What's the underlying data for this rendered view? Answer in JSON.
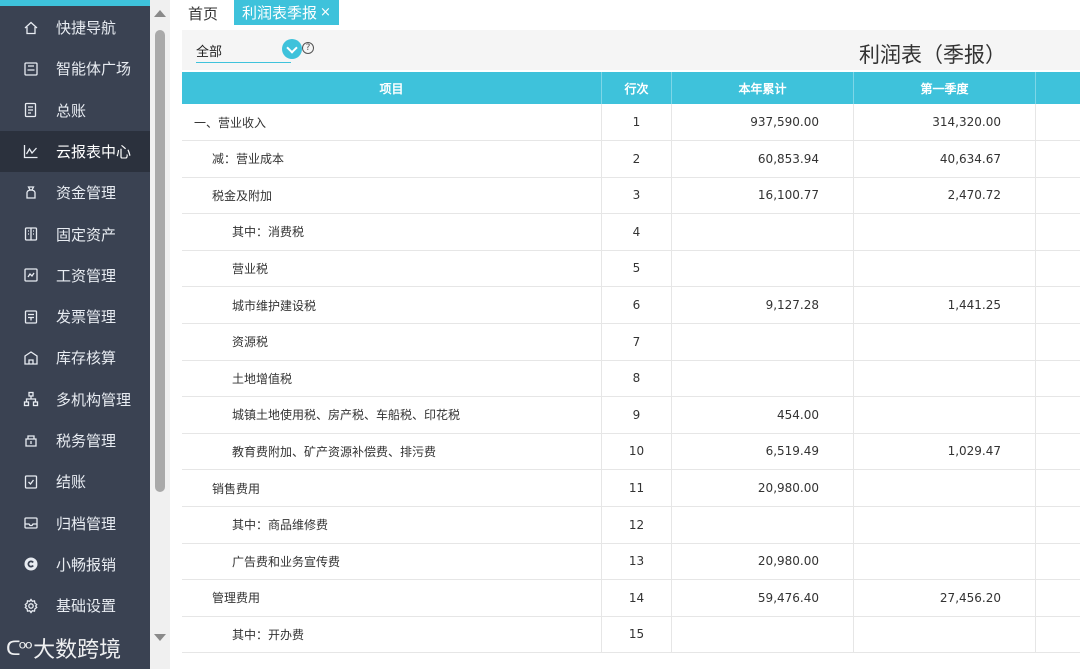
{
  "sidebar": {
    "items": [
      {
        "label": "快捷导航",
        "icon": "home-icon"
      },
      {
        "label": "智能体广场",
        "icon": "agent-icon"
      },
      {
        "label": "总账",
        "icon": "ledger-icon"
      },
      {
        "label": "云报表中心",
        "icon": "chart-icon",
        "active": true
      },
      {
        "label": "资金管理",
        "icon": "money-bag-icon"
      },
      {
        "label": "固定资产",
        "icon": "building-icon"
      },
      {
        "label": "工资管理",
        "icon": "payroll-icon"
      },
      {
        "label": "发票管理",
        "icon": "invoice-icon"
      },
      {
        "label": "库存核算",
        "icon": "warehouse-icon"
      },
      {
        "label": "多机构管理",
        "icon": "org-icon"
      },
      {
        "label": "税务管理",
        "icon": "tax-icon"
      },
      {
        "label": "结账",
        "icon": "checkout-icon"
      },
      {
        "label": "归档管理",
        "icon": "archive-icon"
      },
      {
        "label": "小畅报销",
        "icon": "reimburse-icon"
      },
      {
        "label": "基础设置",
        "icon": "settings-icon"
      }
    ],
    "watermark": "大数跨境"
  },
  "tabs": {
    "home": "首页",
    "active": "利润表季报",
    "close": "×"
  },
  "filter": {
    "select_value": "全部",
    "help": "?"
  },
  "report": {
    "title": "利润表（季报）"
  },
  "table": {
    "headers": {
      "item": "项目",
      "line": "行次",
      "ytd": "本年累计",
      "q1": "第一季度"
    },
    "rows": [
      {
        "item": "一、营业收入",
        "line": "1",
        "ytd": "937,590.00",
        "q1": "314,320.00",
        "indent": 0
      },
      {
        "item": "减：营业成本",
        "line": "2",
        "ytd": "60,853.94",
        "q1": "40,634.67",
        "indent": 1
      },
      {
        "item": "税金及附加",
        "line": "3",
        "ytd": "16,100.77",
        "q1": "2,470.72",
        "indent": 1
      },
      {
        "item": "其中：消费税",
        "line": "4",
        "ytd": "",
        "q1": "",
        "indent": 2
      },
      {
        "item": "营业税",
        "line": "5",
        "ytd": "",
        "q1": "",
        "indent": 2
      },
      {
        "item": "城市维护建设税",
        "line": "6",
        "ytd": "9,127.28",
        "q1": "1,441.25",
        "indent": 2
      },
      {
        "item": "资源税",
        "line": "7",
        "ytd": "",
        "q1": "",
        "indent": 2
      },
      {
        "item": "土地增值税",
        "line": "8",
        "ytd": "",
        "q1": "",
        "indent": 2
      },
      {
        "item": "城镇土地使用税、房产税、车船税、印花税",
        "line": "9",
        "ytd": "454.00",
        "q1": "",
        "indent": 2
      },
      {
        "item": "教育费附加、矿产资源补偿费、排污费",
        "line": "10",
        "ytd": "6,519.49",
        "q1": "1,029.47",
        "indent": 2
      },
      {
        "item": "销售费用",
        "line": "11",
        "ytd": "20,980.00",
        "q1": "",
        "indent": 1
      },
      {
        "item": "其中：商品维修费",
        "line": "12",
        "ytd": "",
        "q1": "",
        "indent": 2
      },
      {
        "item": "广告费和业务宣传费",
        "line": "13",
        "ytd": "20,980.00",
        "q1": "",
        "indent": 2
      },
      {
        "item": "管理费用",
        "line": "14",
        "ytd": "59,476.40",
        "q1": "27,456.20",
        "indent": 1
      },
      {
        "item": "其中：开办费",
        "line": "15",
        "ytd": "",
        "q1": "",
        "indent": 2
      }
    ]
  },
  "colors": {
    "accent": "#3ec2db",
    "sidebar_bg": "#3a4252",
    "sidebar_active": "#2b313d"
  }
}
